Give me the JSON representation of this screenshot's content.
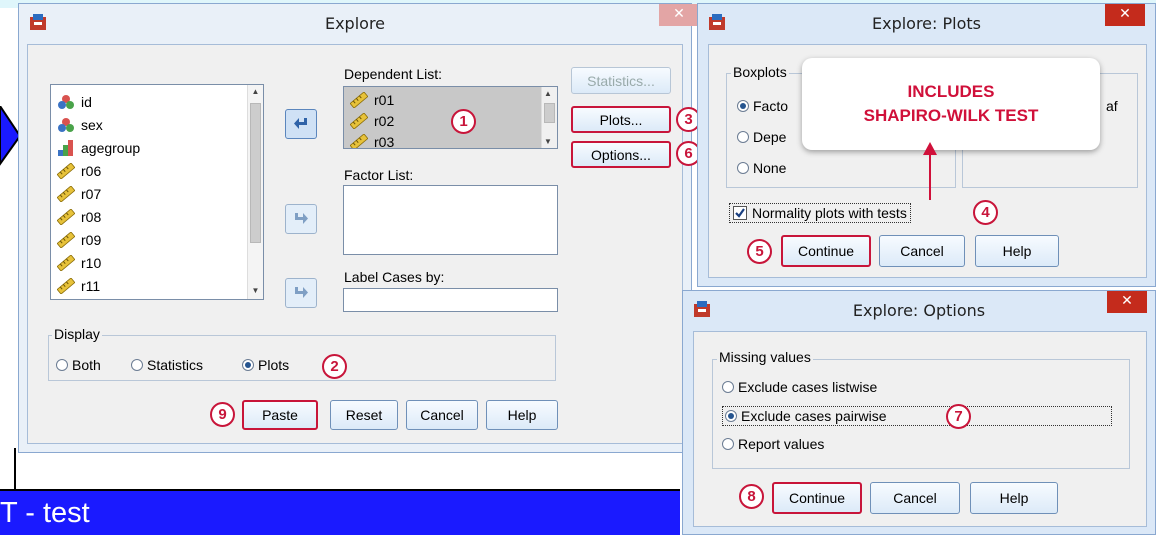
{
  "background_windows": {
    "banner_text": "T - test"
  },
  "explore": {
    "title": "Explore",
    "close_label": "✕",
    "variables": [
      {
        "name": "id",
        "icon": "nominal-icon"
      },
      {
        "name": "sex",
        "icon": "nominal-icon"
      },
      {
        "name": "agegroup",
        "icon": "ordinal-icon"
      },
      {
        "name": "r06",
        "icon": "scale-icon"
      },
      {
        "name": "r07",
        "icon": "scale-icon"
      },
      {
        "name": "r08",
        "icon": "scale-icon"
      },
      {
        "name": "r09",
        "icon": "scale-icon"
      },
      {
        "name": "r10",
        "icon": "scale-icon"
      },
      {
        "name": "r11",
        "icon": "scale-icon"
      }
    ],
    "dependent_list_label": "Dependent List:",
    "dependent_items": [
      "r01",
      "r02",
      "r03"
    ],
    "factor_list_label": "Factor List:",
    "label_cases_label": "Label Cases by:",
    "statistics_button": "Statistics...",
    "plots_button": "Plots...",
    "options_button": "Options...",
    "display_label": "Display",
    "display_options": {
      "both": "Both",
      "statistics": "Statistics",
      "plots": "Plots"
    },
    "display_selected": "plots",
    "paste_button": "Paste",
    "reset_button": "Reset",
    "cancel_button": "Cancel",
    "help_button": "Help"
  },
  "plots_dialog": {
    "title": "Explore: Plots",
    "close_label": "✕",
    "boxplots_label": "Boxplots",
    "factor_option": "Facto",
    "dependents_option": "Depe",
    "none_option": "None",
    "descriptive_partial": "af",
    "normality_label": "Normality plots with tests",
    "normality_checked": true,
    "continue_button": "Continue",
    "cancel_button": "Cancel",
    "help_button": "Help"
  },
  "callout": {
    "line1": "INCLUDES",
    "line2": "SHAPIRO-WILK TEST"
  },
  "options_dialog": {
    "title": "Explore: Options",
    "close_label": "✕",
    "missing_label": "Missing values",
    "listwise": "Exclude cases listwise",
    "pairwise": "Exclude cases pairwise",
    "report": "Report values",
    "selected": "pairwise",
    "continue_button": "Continue",
    "cancel_button": "Cancel",
    "help_button": "Help"
  },
  "steps": [
    "1",
    "2",
    "3",
    "4",
    "5",
    "6",
    "7",
    "8",
    "9"
  ],
  "colors": {
    "accent_red": "#c8153a",
    "banner_blue": "#1a1aff",
    "callout_red": "#d0103a"
  }
}
